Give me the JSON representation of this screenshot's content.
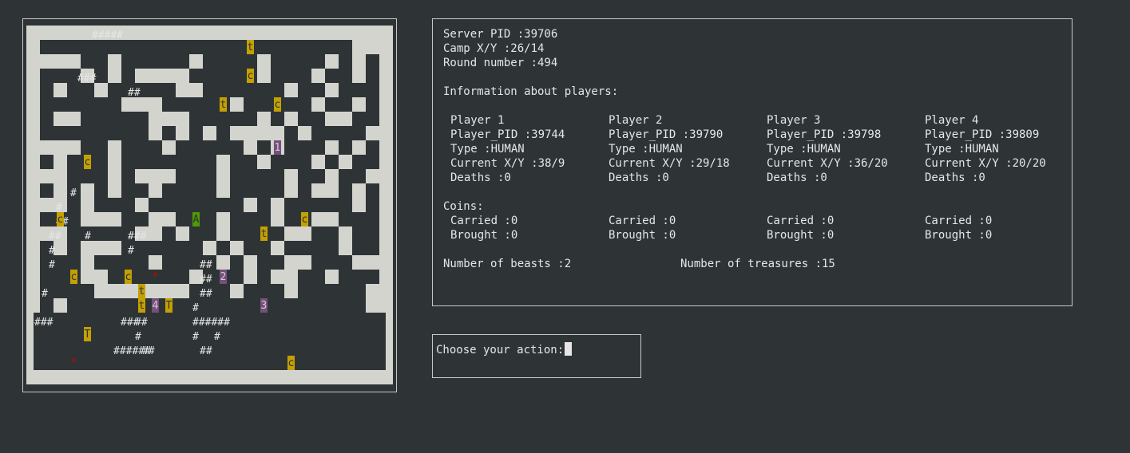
{
  "maze": {
    "rows": [
      "lllllllllllllllllllllllllll",
      "l...........t...........lll",
      "llll..l.....lc...l....l.l.l",
      "l...l.l.llll.....l...l..l.l",
      "l.l..l.....ll.t..c.l..l...l",
      "l......lll.....l.....l..l.l",
      "l.ll...c.lll.....l1l..ll..l",
      "l........l.l.l.llll.l....ll",
      "llll..l...l.....l.l...l.l.l",
      "l.l...l.....A.l..l.c.l.l..l",
      "lll...l.lll...l..t.l..l..ll",
      "l.l.l.l..l....l....l.ll.l.l",
      "lll.l...l.......l.l.....l.l",
      "l...lll.cll.2.l...l..ll...l",
      "lll...ttll.l..l....ll..l..l",
      "l.l.lll..4T..l.l.3l....l..l",
      "l...l....l....l.l..ll...lll",
      "l...llT.....l...l.ll..l...l",
      "l....lllllll...l...l.....ll",
      "l.l...........c..........ll",
      "lllllllllllllllllllllllllll"
    ],
    "hash_marks": [
      {
        "r": 1,
        "c": 8,
        "t": "#####"
      },
      {
        "r": 4,
        "c": 6,
        "t": "###"
      },
      {
        "r": 5,
        "c": 13,
        "t": "##"
      },
      {
        "r": 12,
        "c": 5,
        "t": "#"
      },
      {
        "r": 13,
        "c": 3,
        "t": "#"
      },
      {
        "r": 14,
        "c": 3,
        "t": "##"
      },
      {
        "r": 15,
        "c": 2,
        "t": "##"
      },
      {
        "r": 15,
        "c": 7,
        "t": "#"
      },
      {
        "r": 15,
        "c": 13,
        "t": "###"
      },
      {
        "r": 16,
        "c": 2,
        "t": "#"
      },
      {
        "r": 16,
        "c": 13,
        "t": "#"
      },
      {
        "r": 17,
        "c": 2,
        "t": "#"
      },
      {
        "r": 17,
        "c": 23,
        "t": "##"
      },
      {
        "r": 18,
        "c": 23,
        "t": "##"
      },
      {
        "r": 19,
        "c": 1,
        "t": "#"
      },
      {
        "r": 19,
        "c": 23,
        "t": "##"
      },
      {
        "r": 20,
        "c": 22,
        "t": "#"
      },
      {
        "r": 21,
        "c": 0,
        "t": "###"
      },
      {
        "r": 21,
        "c": 12,
        "t": "###"
      },
      {
        "r": 21,
        "c": 14,
        "t": "##"
      },
      {
        "r": 21,
        "c": 22,
        "t": "######"
      },
      {
        "r": 22,
        "c": 14,
        "t": "#"
      },
      {
        "r": 22,
        "c": 22,
        "t": "#"
      },
      {
        "r": 22,
        "c": 25,
        "t": "#"
      },
      {
        "r": 23,
        "c": 11,
        "t": "######"
      },
      {
        "r": 23,
        "c": 15,
        "t": "##"
      },
      {
        "r": 23,
        "c": 23,
        "t": "##"
      }
    ],
    "tiles": [
      {
        "r": 1,
        "c": 16,
        "t": "t",
        "kind": "treasure"
      },
      {
        "r": 3,
        "c": 16,
        "t": "c",
        "kind": "treasure"
      },
      {
        "r": 5,
        "c": 14,
        "t": "t",
        "kind": "treasure"
      },
      {
        "r": 5,
        "c": 18,
        "t": "c",
        "kind": "treasure"
      },
      {
        "r": 8,
        "c": 18,
        "t": "1",
        "kind": "player"
      },
      {
        "r": 9,
        "c": 4,
        "t": "c",
        "kind": "treasure"
      },
      {
        "r": 13,
        "c": 2,
        "t": "c",
        "kind": "treasure"
      },
      {
        "r": 13,
        "c": 12,
        "t": "A",
        "kind": "camp"
      },
      {
        "r": 13,
        "c": 20,
        "t": "c",
        "kind": "treasure"
      },
      {
        "r": 14,
        "c": 17,
        "t": "t",
        "kind": "treasure"
      },
      {
        "r": 17,
        "c": 3,
        "t": "c",
        "kind": "treasure"
      },
      {
        "r": 17,
        "c": 7,
        "t": "c",
        "kind": "treasure"
      },
      {
        "r": 17,
        "c": 9,
        "t": "*",
        "kind": "beast"
      },
      {
        "r": 17,
        "c": 14,
        "t": "2",
        "kind": "player"
      },
      {
        "r": 18,
        "c": 8,
        "t": "t",
        "kind": "treasure"
      },
      {
        "r": 19,
        "c": 8,
        "t": "t",
        "kind": "treasure"
      },
      {
        "r": 19,
        "c": 9,
        "t": "4",
        "kind": "player"
      },
      {
        "r": 19,
        "c": 10,
        "t": "T",
        "kind": "treasure"
      },
      {
        "r": 19,
        "c": 17,
        "t": "3",
        "kind": "player"
      },
      {
        "r": 21,
        "c": 4,
        "t": "T",
        "kind": "treasure"
      },
      {
        "r": 23,
        "c": 3,
        "t": "*",
        "kind": "beast"
      },
      {
        "r": 23,
        "c": 19,
        "t": "c",
        "kind": "treasure"
      }
    ]
  },
  "server": {
    "pid_line": "Server PID :39706",
    "camp_line": "Camp X/Y :26/14",
    "round_line": "Round number :494"
  },
  "players_heading": "Information about players:",
  "players": [
    {
      "name": "Player 1",
      "pid": "Player_PID :39744",
      "type": "Type :HUMAN",
      "pos": "Current X/Y :38/9",
      "deaths": "Deaths :0",
      "carried": "Carried :0",
      "brought": "Brought :0"
    },
    {
      "name": "Player 2",
      "pid": "Player_PID :39790",
      "type": "Type :HUMAN",
      "pos": "Current X/Y :29/18",
      "deaths": "Deaths :0",
      "carried": "Carried :0",
      "brought": "Brought :0"
    },
    {
      "name": "Player 3",
      "pid": "Player_PID :39798",
      "type": "Type :HUMAN",
      "pos": "Current X/Y :36/20",
      "deaths": "Deaths :0",
      "carried": "Carried :0",
      "brought": "Brought :0"
    },
    {
      "name": "Player 4",
      "pid": "Player_PID :39809",
      "type": "Type :HUMAN",
      "pos": "Current X/Y :20/20",
      "deaths": "Deaths :0",
      "carried": "Carried :0",
      "brought": "Brought :0"
    }
  ],
  "coins_heading": "Coins:",
  "beasts_line": "Number of beasts :2",
  "treasures_line": "Number of treasures :15",
  "action_prompt": "Choose your action:",
  "colors": {
    "background": "#2e3436",
    "wall": "#d3d4ce",
    "treasure": "#c4a000",
    "player": "#75507b",
    "camp": "#4e9a06",
    "beast": "#cc0000",
    "text": "#e6e6e6"
  }
}
